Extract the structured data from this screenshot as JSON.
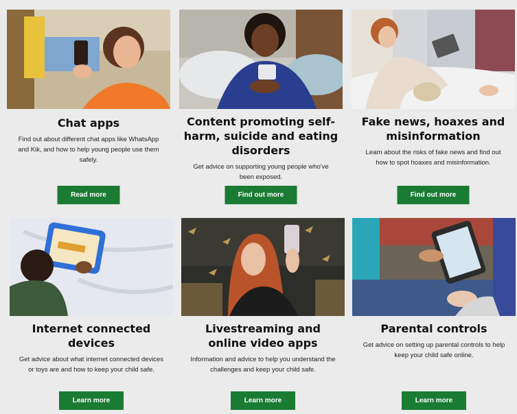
{
  "cards": [
    {
      "title": "Chat apps",
      "description": "Find out about different chat apps like WhatsApp and Kik, and how to help young people use them safely.",
      "button_label": "Read more"
    },
    {
      "title": "Content promoting self-harm, suicide and eating disorders",
      "description": "Get advice on supporting young people who've been exposed.",
      "button_label": "Find out more"
    },
    {
      "title": "Fake news, hoaxes and misinformation",
      "description": "Learn about the risks of fake news and find out how to spot hoaxes and misinformation.",
      "button_label": "Find out more"
    },
    {
      "title": "Internet connected devices",
      "description": "Get advice about what internet connected devices or toys are and how to keep your child safe.",
      "button_label": "Learn more"
    },
    {
      "title": "Livestreaming and online video apps",
      "description": "Information and advice to help you understand the challenges and keep your child safe.",
      "button_label": "Learn more"
    },
    {
      "title": "Parental controls",
      "description": "Get advice on setting up parental controls to help keep your child safe online.",
      "button_label": "Learn more"
    }
  ],
  "colors": {
    "page_background": "#ebebeb",
    "button_green": "#1a7b33",
    "button_text": "#ffffff",
    "title_text": "#111111"
  }
}
